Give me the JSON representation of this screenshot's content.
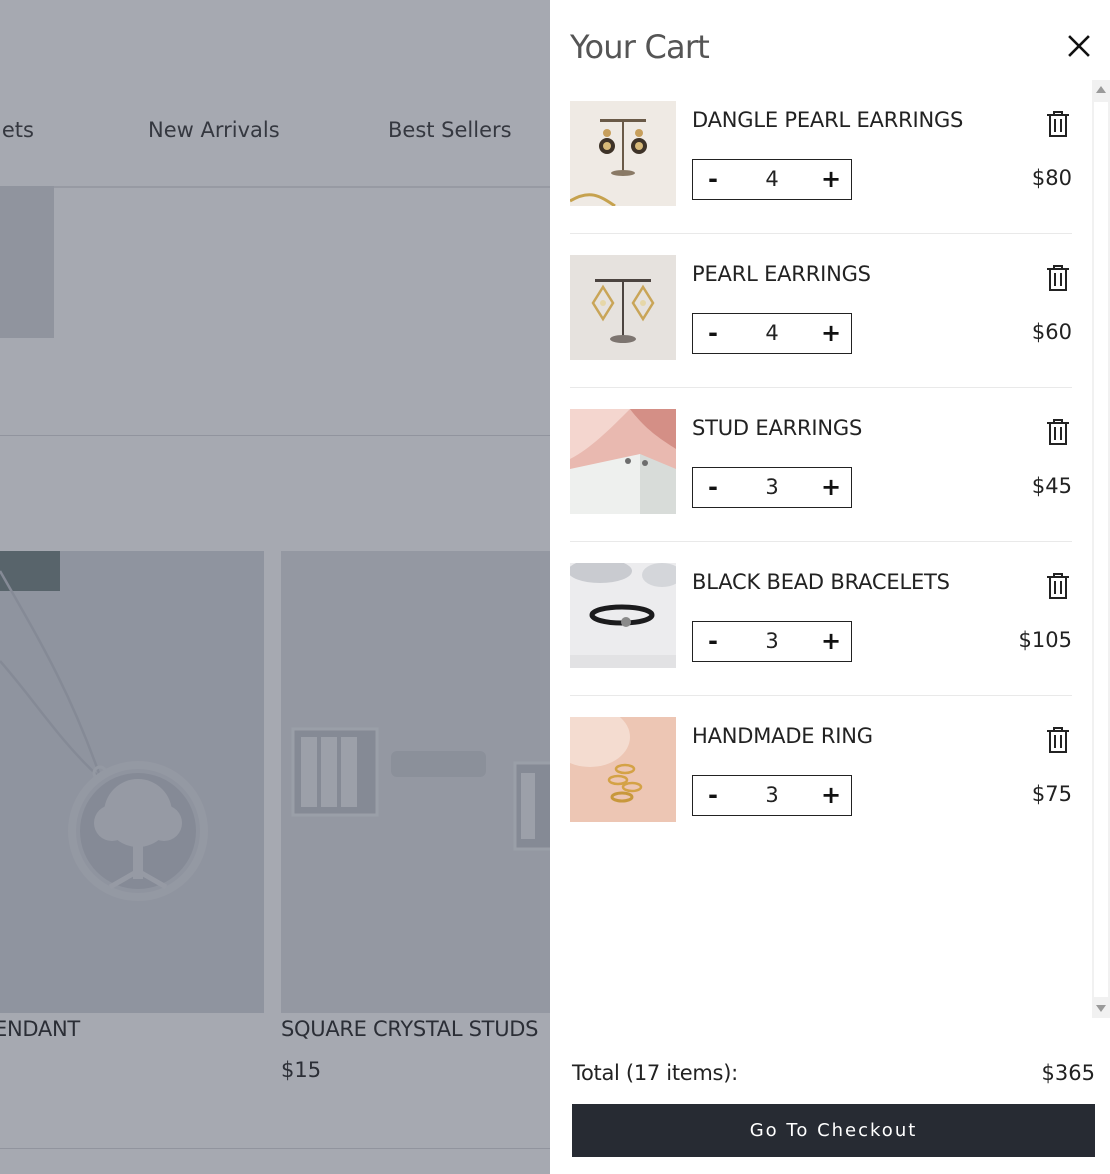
{
  "background": {
    "nav": [
      "lets",
      "New Arrivals",
      "Best Sellers"
    ],
    "products": [
      {
        "title": "ENDANT",
        "price": ""
      },
      {
        "title": "SQUARE CRYSTAL STUDS",
        "price": "$15"
      }
    ]
  },
  "cart": {
    "title": "Your Cart",
    "close_icon": "close-icon",
    "items": [
      {
        "name": "DANGLE PEARL EARRINGS",
        "quantity": "4",
        "price": "$80"
      },
      {
        "name": "PEARL EARRINGS",
        "quantity": "4",
        "price": "$60"
      },
      {
        "name": "STUD EARRINGS",
        "quantity": "3",
        "price": "$45"
      },
      {
        "name": "BLACK BEAD BRACELETS",
        "quantity": "3",
        "price": "$105"
      },
      {
        "name": "HANDMADE RING",
        "quantity": "3",
        "price": "$75"
      }
    ],
    "minus_label": "-",
    "plus_label": "+",
    "total_label": "Total (17 items):",
    "total_value": "$365",
    "checkout_label": "Go To Checkout"
  },
  "colors": {
    "overlay": "#21283c",
    "checkout_bg": "#272b33"
  }
}
